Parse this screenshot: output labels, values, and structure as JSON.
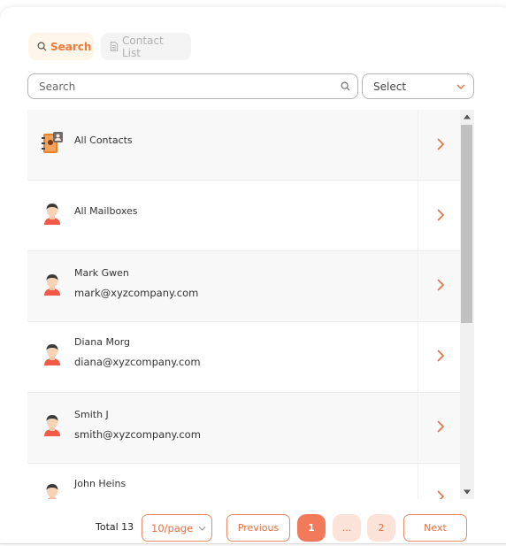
{
  "tabs": [
    {
      "label": "Search",
      "icon": "search-icon",
      "active": true
    },
    {
      "label": "Contact List",
      "icon": "document-icon",
      "active": false
    }
  ],
  "search": {
    "placeholder": "Search",
    "value": ""
  },
  "filter": {
    "selected": "Select"
  },
  "contacts": [
    {
      "name": "All Contacts",
      "email": "",
      "icon": "address-book-icon"
    },
    {
      "name": "All Mailboxes",
      "email": "",
      "icon": "user-avatar-icon"
    },
    {
      "name": "Mark Gwen",
      "email": "mark@xyzcompany.com",
      "icon": "user-avatar-icon"
    },
    {
      "name": "Diana Morg",
      "email": "diana@xyzcompany.com",
      "icon": "user-avatar-icon"
    },
    {
      "name": "Smith J",
      "email": "smith@xyzcompany.com",
      "icon": "user-avatar-icon"
    },
    {
      "name": "John Heins",
      "email": "",
      "icon": "user-avatar-icon"
    }
  ],
  "pagination": {
    "total_label": "Total 13",
    "page_size": "10/page",
    "previous": "Previous",
    "next": "Next",
    "pages": [
      "1",
      "...",
      "2"
    ],
    "current": "1"
  },
  "colors": {
    "accent": "#f07a3a",
    "active_page": "#f07a5a",
    "inactive_page": "#fbe3da"
  }
}
